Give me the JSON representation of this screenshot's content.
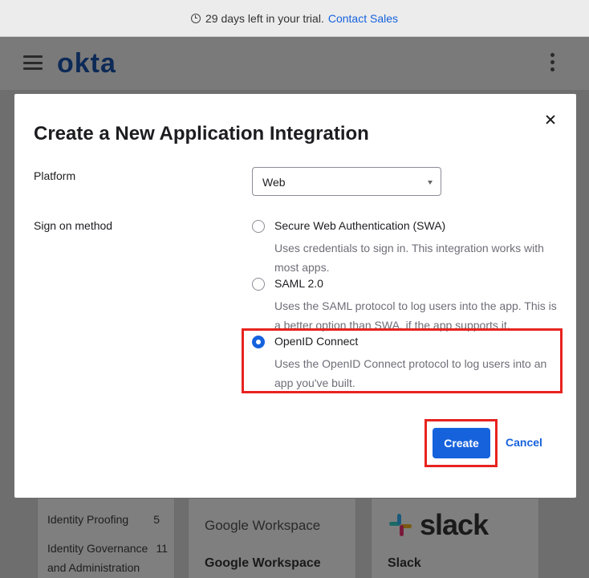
{
  "trial_bar": {
    "text": "29 days left in your trial.",
    "link": "Contact Sales"
  },
  "header": {
    "logo": "okta"
  },
  "background": {
    "categories": [
      {
        "label": "Identity Proofing",
        "count": "5"
      },
      {
        "label": "Identity Governance and Administration",
        "count": "11"
      }
    ],
    "cards": [
      {
        "logo": "Google Workspace",
        "title": "Google Workspace"
      },
      {
        "logo": "slack",
        "title": "Slack"
      }
    ]
  },
  "modal": {
    "title": "Create a New Application Integration",
    "platform_label": "Platform",
    "platform_value": "Web",
    "sign_on_label": "Sign on method",
    "options": [
      {
        "label": "Secure Web Authentication (SWA)",
        "description": "Uses credentials to sign in. This integration works with most apps.",
        "checked": false
      },
      {
        "label": "SAML 2.0",
        "description": "Uses the SAML protocol to log users into the app. This is a better option than SWA, if the app supports it.",
        "checked": false
      },
      {
        "label": "OpenID Connect",
        "description": "Uses the OpenID Connect protocol to log users into an app you've built.",
        "checked": true
      }
    ],
    "create_label": "Create",
    "cancel_label": "Cancel"
  },
  "colors": {
    "accent": "#1662dd",
    "highlight": "#e8231f",
    "logo": "#0d2a57"
  }
}
